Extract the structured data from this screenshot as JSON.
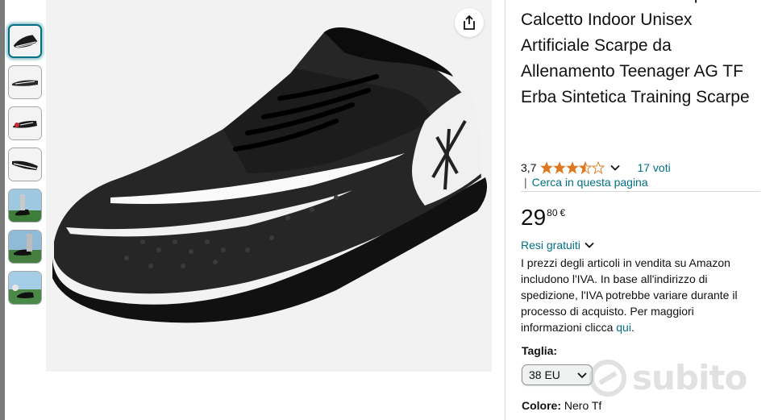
{
  "product": {
    "title": "Uomo Donna Turf Scarpe da Calcetto Indoor Unisex Artificiale Scarpe da Allenamento Teenager AG TF Erba Sintetica Training Scarpe",
    "rating_value": "3,7",
    "rating_stars": 3.7,
    "votes": "17 voti",
    "search_link": "Cerca in questa pagina",
    "search_separator": "|"
  },
  "price": {
    "whole": "29",
    "fraction": "80",
    "currency": "€"
  },
  "returns": {
    "label": "Resi gratuiti"
  },
  "vat_notice": {
    "text": "I prezzi degli articoli in vendita su Amazon includono l'IVA. In base all'indirizzo di spedizione, l'IVA potrebbe variare durante il processo di acquisto. Per maggiori informazioni clicca ",
    "link": "qui",
    "end": "."
  },
  "size": {
    "label": "Taglia:",
    "selected": "38 EU"
  },
  "color": {
    "label": "Colore:",
    "value": "Nero Tf"
  },
  "watermark": {
    "text": "subito"
  },
  "colors": {
    "link": "#007185",
    "star": "#de7921",
    "text": "#0f1111",
    "thumb_active": "#007185"
  },
  "icons": {
    "share": "share-icon",
    "star": "star-icon",
    "chevron": "chevron-down-icon"
  }
}
